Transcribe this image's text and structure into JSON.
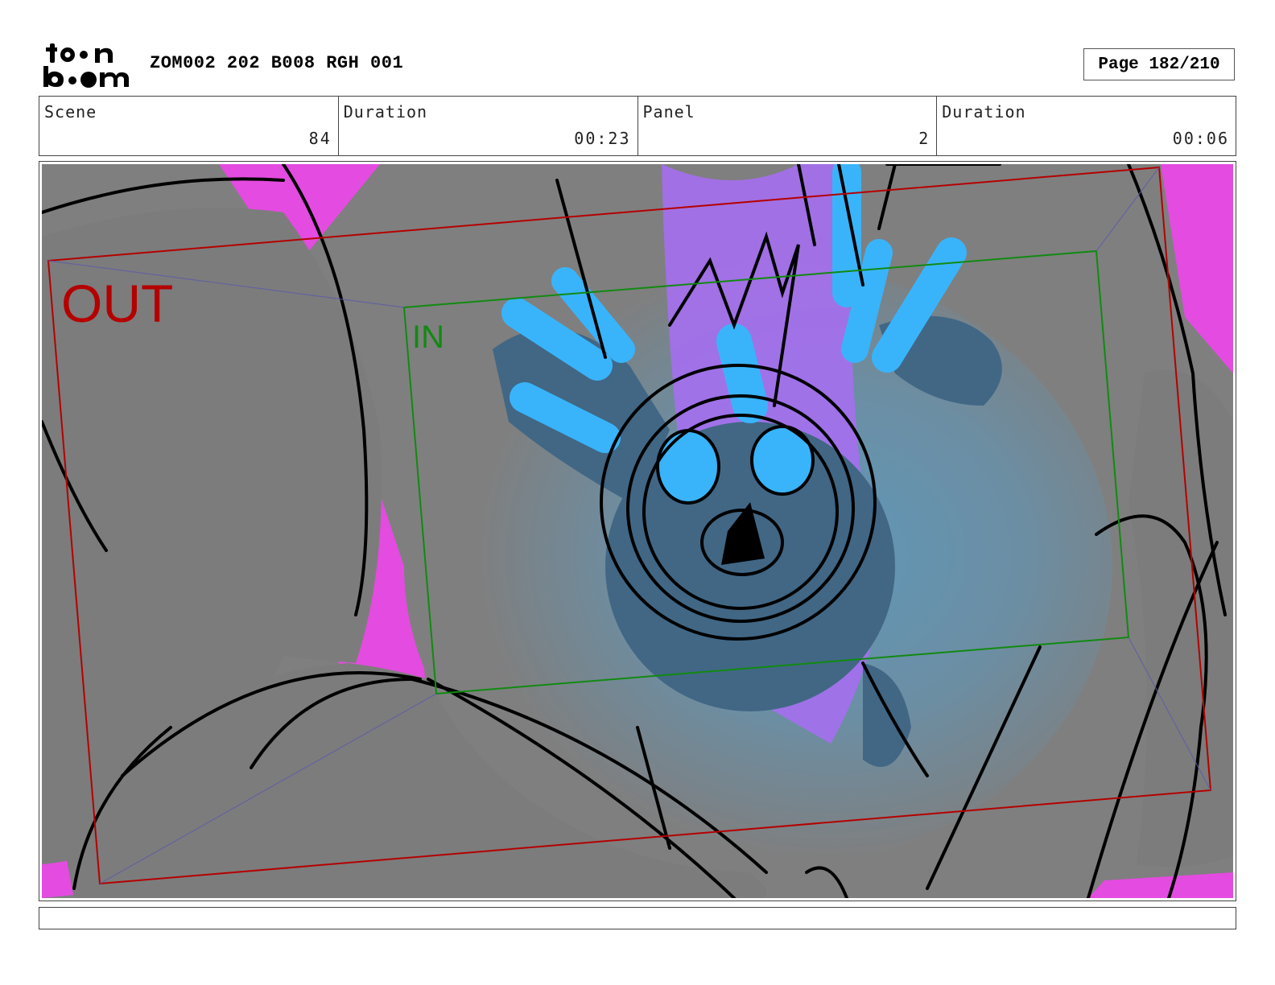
{
  "header": {
    "logo_text": "toonboom",
    "project_title": "ZOM002 202 B008 RGH 001",
    "page_label": "Page 182/210"
  },
  "info": {
    "scene_label": "Scene",
    "scene_value": "84",
    "scene_duration_label": "Duration",
    "scene_duration_value": "00:23",
    "panel_label": "Panel",
    "panel_value": "2",
    "panel_duration_label": "Duration",
    "panel_duration_value": "00:06"
  },
  "panel": {
    "out_label": "OUT",
    "in_label": "IN"
  },
  "caption": {
    "text": ""
  },
  "colors": {
    "background_gray": "#7f7f7f",
    "magenta": "#e44be0",
    "violet": "#a56ff0",
    "glow_blue": "#5e93b3",
    "light_blue": "#39b4fb",
    "dark_blue": "#416785",
    "out_red": "#b50000",
    "in_green": "#118a11"
  }
}
